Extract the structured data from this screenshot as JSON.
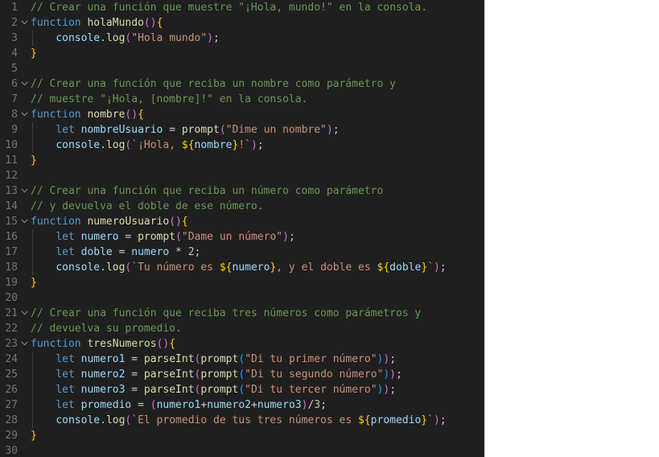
{
  "editor": {
    "theme": "dark-modern",
    "language": "javascript",
    "background_color": "#1f1f1f",
    "gutter_color": "#6e7681",
    "side_panel_color": "#ffffff",
    "token_colors": {
      "comment": "#6A9955",
      "keyword": "#569CD6",
      "function": "#DCDCAA",
      "variable": "#9CDCFE",
      "string": "#CE9178",
      "number": "#B5CEA8",
      "plain": "#CCCCCC",
      "bracket_1": "#FFD700",
      "bracket_2": "#DA70D6",
      "bracket_3": "#179FFF"
    },
    "first_visible_line": 1,
    "last_visible_line": 30,
    "lines": [
      {
        "number": "1",
        "fold": false,
        "guide": false,
        "indent": 0,
        "tokens": [
          {
            "text": "// Crear una función que muestre \"¡Hola, mundo!\" en la consola.",
            "cls": "t-comment"
          }
        ]
      },
      {
        "number": "2",
        "fold": true,
        "guide": false,
        "indent": 0,
        "tokens": [
          {
            "text": "function ",
            "cls": "t-keyword"
          },
          {
            "text": "holaMundo",
            "cls": "t-func"
          },
          {
            "text": "(",
            "cls": "t-p2"
          },
          {
            "text": ")",
            "cls": "t-p2"
          },
          {
            "text": "{",
            "cls": "t-p1"
          }
        ]
      },
      {
        "number": "3",
        "fold": false,
        "guide": true,
        "indent": 1,
        "tokens": [
          {
            "text": "    ",
            "cls": "t-plain"
          },
          {
            "text": "console",
            "cls": "t-var"
          },
          {
            "text": ".",
            "cls": "t-plain"
          },
          {
            "text": "log",
            "cls": "t-func"
          },
          {
            "text": "(",
            "cls": "t-p2"
          },
          {
            "text": "\"Hola mundo\"",
            "cls": "t-string"
          },
          {
            "text": ")",
            "cls": "t-p2"
          },
          {
            "text": ";",
            "cls": "t-plain"
          }
        ]
      },
      {
        "number": "4",
        "fold": false,
        "guide": false,
        "indent": 0,
        "tokens": [
          {
            "text": "}",
            "cls": "t-p1"
          }
        ]
      },
      {
        "number": "5",
        "fold": false,
        "guide": false,
        "indent": 0,
        "tokens": []
      },
      {
        "number": "6",
        "fold": true,
        "guide": false,
        "indent": 0,
        "tokens": [
          {
            "text": "// Crear una función que reciba un nombre como parámetro y",
            "cls": "t-comment"
          }
        ]
      },
      {
        "number": "7",
        "fold": false,
        "guide": false,
        "indent": 0,
        "tokens": [
          {
            "text": "// muestre \"¡Hola, [nombre]!\" en la consola.",
            "cls": "t-comment"
          }
        ]
      },
      {
        "number": "8",
        "fold": true,
        "guide": false,
        "indent": 0,
        "tokens": [
          {
            "text": "function ",
            "cls": "t-keyword"
          },
          {
            "text": "nombre",
            "cls": "t-func"
          },
          {
            "text": "(",
            "cls": "t-p2"
          },
          {
            "text": ")",
            "cls": "t-p2"
          },
          {
            "text": "{",
            "cls": "t-p1"
          }
        ]
      },
      {
        "number": "9",
        "fold": false,
        "guide": true,
        "indent": 1,
        "tokens": [
          {
            "text": "    ",
            "cls": "t-plain"
          },
          {
            "text": "let",
            "cls": "t-keyword"
          },
          {
            "text": " ",
            "cls": "t-plain"
          },
          {
            "text": "nombreUsuario",
            "cls": "t-var"
          },
          {
            "text": " = ",
            "cls": "t-plain"
          },
          {
            "text": "prompt",
            "cls": "t-func"
          },
          {
            "text": "(",
            "cls": "t-p2"
          },
          {
            "text": "\"Dime un nombre\"",
            "cls": "t-string"
          },
          {
            "text": ")",
            "cls": "t-p2"
          },
          {
            "text": ";",
            "cls": "t-plain"
          }
        ]
      },
      {
        "number": "10",
        "fold": false,
        "guide": true,
        "indent": 1,
        "tokens": [
          {
            "text": "    ",
            "cls": "t-plain"
          },
          {
            "text": "console",
            "cls": "t-var"
          },
          {
            "text": ".",
            "cls": "t-plain"
          },
          {
            "text": "log",
            "cls": "t-func"
          },
          {
            "text": "(",
            "cls": "t-p2"
          },
          {
            "text": "`¡Hola, ",
            "cls": "t-string"
          },
          {
            "text": "${",
            "cls": "t-p1"
          },
          {
            "text": "nombre",
            "cls": "t-var"
          },
          {
            "text": "}",
            "cls": "t-p1"
          },
          {
            "text": "!`",
            "cls": "t-string"
          },
          {
            "text": ")",
            "cls": "t-p2"
          },
          {
            "text": ";",
            "cls": "t-plain"
          }
        ]
      },
      {
        "number": "11",
        "fold": false,
        "guide": false,
        "indent": 0,
        "tokens": [
          {
            "text": "}",
            "cls": "t-p1"
          }
        ]
      },
      {
        "number": "12",
        "fold": false,
        "guide": false,
        "indent": 0,
        "tokens": []
      },
      {
        "number": "13",
        "fold": true,
        "guide": false,
        "indent": 0,
        "tokens": [
          {
            "text": "// Crear una función que reciba un número como parámetro",
            "cls": "t-comment"
          }
        ]
      },
      {
        "number": "14",
        "fold": false,
        "guide": false,
        "indent": 0,
        "tokens": [
          {
            "text": "// y devuelva el doble de ese número.",
            "cls": "t-comment"
          }
        ]
      },
      {
        "number": "15",
        "fold": true,
        "guide": false,
        "indent": 0,
        "tokens": [
          {
            "text": "function ",
            "cls": "t-keyword"
          },
          {
            "text": "numeroUsuario",
            "cls": "t-func"
          },
          {
            "text": "(",
            "cls": "t-p2"
          },
          {
            "text": ")",
            "cls": "t-p2"
          },
          {
            "text": "{",
            "cls": "t-p1"
          }
        ]
      },
      {
        "number": "16",
        "fold": false,
        "guide": true,
        "indent": 1,
        "tokens": [
          {
            "text": "    ",
            "cls": "t-plain"
          },
          {
            "text": "let",
            "cls": "t-keyword"
          },
          {
            "text": " ",
            "cls": "t-plain"
          },
          {
            "text": "numero",
            "cls": "t-var"
          },
          {
            "text": " = ",
            "cls": "t-plain"
          },
          {
            "text": "prompt",
            "cls": "t-func"
          },
          {
            "text": "(",
            "cls": "t-p2"
          },
          {
            "text": "\"Dame un número\"",
            "cls": "t-string"
          },
          {
            "text": ")",
            "cls": "t-p2"
          },
          {
            "text": ";",
            "cls": "t-plain"
          }
        ]
      },
      {
        "number": "17",
        "fold": false,
        "guide": true,
        "indent": 1,
        "tokens": [
          {
            "text": "    ",
            "cls": "t-plain"
          },
          {
            "text": "let",
            "cls": "t-keyword"
          },
          {
            "text": " ",
            "cls": "t-plain"
          },
          {
            "text": "doble",
            "cls": "t-var"
          },
          {
            "text": " = ",
            "cls": "t-plain"
          },
          {
            "text": "numero",
            "cls": "t-var"
          },
          {
            "text": " * ",
            "cls": "t-plain"
          },
          {
            "text": "2",
            "cls": "t-number"
          },
          {
            "text": ";",
            "cls": "t-plain"
          }
        ]
      },
      {
        "number": "18",
        "fold": false,
        "guide": true,
        "indent": 1,
        "tokens": [
          {
            "text": "    ",
            "cls": "t-plain"
          },
          {
            "text": "console",
            "cls": "t-var"
          },
          {
            "text": ".",
            "cls": "t-plain"
          },
          {
            "text": "log",
            "cls": "t-func"
          },
          {
            "text": "(",
            "cls": "t-p2"
          },
          {
            "text": "`Tu número es ",
            "cls": "t-string"
          },
          {
            "text": "${",
            "cls": "t-p1"
          },
          {
            "text": "numero",
            "cls": "t-var"
          },
          {
            "text": "}",
            "cls": "t-p1"
          },
          {
            "text": ", y el doble es ",
            "cls": "t-string"
          },
          {
            "text": "${",
            "cls": "t-p1"
          },
          {
            "text": "doble",
            "cls": "t-var"
          },
          {
            "text": "}",
            "cls": "t-p1"
          },
          {
            "text": "`",
            "cls": "t-string"
          },
          {
            "text": ")",
            "cls": "t-p2"
          },
          {
            "text": ";",
            "cls": "t-plain"
          }
        ]
      },
      {
        "number": "19",
        "fold": false,
        "guide": false,
        "indent": 0,
        "tokens": [
          {
            "text": "}",
            "cls": "t-p1"
          }
        ]
      },
      {
        "number": "20",
        "fold": false,
        "guide": false,
        "indent": 0,
        "tokens": []
      },
      {
        "number": "21",
        "fold": true,
        "guide": false,
        "indent": 0,
        "tokens": [
          {
            "text": "// Crear una función que reciba tres números como parámetros y",
            "cls": "t-comment"
          }
        ]
      },
      {
        "number": "22",
        "fold": false,
        "guide": false,
        "indent": 0,
        "tokens": [
          {
            "text": "// devuelva su promedio.",
            "cls": "t-comment"
          }
        ]
      },
      {
        "number": "23",
        "fold": true,
        "guide": false,
        "indent": 0,
        "tokens": [
          {
            "text": "function ",
            "cls": "t-keyword"
          },
          {
            "text": "tresNumeros",
            "cls": "t-func"
          },
          {
            "text": "(",
            "cls": "t-p2"
          },
          {
            "text": ")",
            "cls": "t-p2"
          },
          {
            "text": "{",
            "cls": "t-p1"
          }
        ]
      },
      {
        "number": "24",
        "fold": false,
        "guide": true,
        "indent": 1,
        "tokens": [
          {
            "text": "    ",
            "cls": "t-plain"
          },
          {
            "text": "let",
            "cls": "t-keyword"
          },
          {
            "text": " ",
            "cls": "t-plain"
          },
          {
            "text": "numero1",
            "cls": "t-var"
          },
          {
            "text": " = ",
            "cls": "t-plain"
          },
          {
            "text": "parseInt",
            "cls": "t-func"
          },
          {
            "text": "(",
            "cls": "t-p2"
          },
          {
            "text": "prompt",
            "cls": "t-func"
          },
          {
            "text": "(",
            "cls": "t-p3"
          },
          {
            "text": "\"Di tu primer número\"",
            "cls": "t-string"
          },
          {
            "text": ")",
            "cls": "t-p3"
          },
          {
            "text": ")",
            "cls": "t-p2"
          },
          {
            "text": ";",
            "cls": "t-plain"
          }
        ]
      },
      {
        "number": "25",
        "fold": false,
        "guide": true,
        "indent": 1,
        "tokens": [
          {
            "text": "    ",
            "cls": "t-plain"
          },
          {
            "text": "let",
            "cls": "t-keyword"
          },
          {
            "text": " ",
            "cls": "t-plain"
          },
          {
            "text": "numero2",
            "cls": "t-var"
          },
          {
            "text": " = ",
            "cls": "t-plain"
          },
          {
            "text": "parseInt",
            "cls": "t-func"
          },
          {
            "text": "(",
            "cls": "t-p2"
          },
          {
            "text": "prompt",
            "cls": "t-func"
          },
          {
            "text": "(",
            "cls": "t-p3"
          },
          {
            "text": "\"Di tu segundo número\"",
            "cls": "t-string"
          },
          {
            "text": ")",
            "cls": "t-p3"
          },
          {
            "text": ")",
            "cls": "t-p2"
          },
          {
            "text": ";",
            "cls": "t-plain"
          }
        ]
      },
      {
        "number": "26",
        "fold": false,
        "guide": true,
        "indent": 1,
        "tokens": [
          {
            "text": "    ",
            "cls": "t-plain"
          },
          {
            "text": "let",
            "cls": "t-keyword"
          },
          {
            "text": " ",
            "cls": "t-plain"
          },
          {
            "text": "numero3",
            "cls": "t-var"
          },
          {
            "text": " = ",
            "cls": "t-plain"
          },
          {
            "text": "parseInt",
            "cls": "t-func"
          },
          {
            "text": "(",
            "cls": "t-p2"
          },
          {
            "text": "prompt",
            "cls": "t-func"
          },
          {
            "text": "(",
            "cls": "t-p3"
          },
          {
            "text": "\"Di tu tercer número\"",
            "cls": "t-string"
          },
          {
            "text": ")",
            "cls": "t-p3"
          },
          {
            "text": ")",
            "cls": "t-p2"
          },
          {
            "text": ";",
            "cls": "t-plain"
          }
        ]
      },
      {
        "number": "27",
        "fold": false,
        "guide": true,
        "indent": 1,
        "tokens": [
          {
            "text": "    ",
            "cls": "t-plain"
          },
          {
            "text": "let",
            "cls": "t-keyword"
          },
          {
            "text": " ",
            "cls": "t-plain"
          },
          {
            "text": "promedio",
            "cls": "t-var"
          },
          {
            "text": " = ",
            "cls": "t-plain"
          },
          {
            "text": "(",
            "cls": "t-p2"
          },
          {
            "text": "numero1",
            "cls": "t-var"
          },
          {
            "text": "+",
            "cls": "t-plain"
          },
          {
            "text": "numero2",
            "cls": "t-var"
          },
          {
            "text": "+",
            "cls": "t-plain"
          },
          {
            "text": "numero3",
            "cls": "t-var"
          },
          {
            "text": ")",
            "cls": "t-p2"
          },
          {
            "text": "/",
            "cls": "t-plain"
          },
          {
            "text": "3",
            "cls": "t-number"
          },
          {
            "text": ";",
            "cls": "t-plain"
          }
        ]
      },
      {
        "number": "28",
        "fold": false,
        "guide": true,
        "indent": 1,
        "tokens": [
          {
            "text": "    ",
            "cls": "t-plain"
          },
          {
            "text": "console",
            "cls": "t-var"
          },
          {
            "text": ".",
            "cls": "t-plain"
          },
          {
            "text": "log",
            "cls": "t-func"
          },
          {
            "text": "(",
            "cls": "t-p2"
          },
          {
            "text": "`El promedio de tus tres números es ",
            "cls": "t-string"
          },
          {
            "text": "${",
            "cls": "t-p1"
          },
          {
            "text": "promedio",
            "cls": "t-var"
          },
          {
            "text": "}",
            "cls": "t-p1"
          },
          {
            "text": "`",
            "cls": "t-string"
          },
          {
            "text": ")",
            "cls": "t-p2"
          },
          {
            "text": ";",
            "cls": "t-plain"
          }
        ]
      },
      {
        "number": "29",
        "fold": false,
        "guide": false,
        "indent": 0,
        "tokens": [
          {
            "text": "}",
            "cls": "t-p1"
          }
        ]
      },
      {
        "number": "30",
        "fold": false,
        "guide": false,
        "indent": 0,
        "tokens": []
      }
    ]
  }
}
